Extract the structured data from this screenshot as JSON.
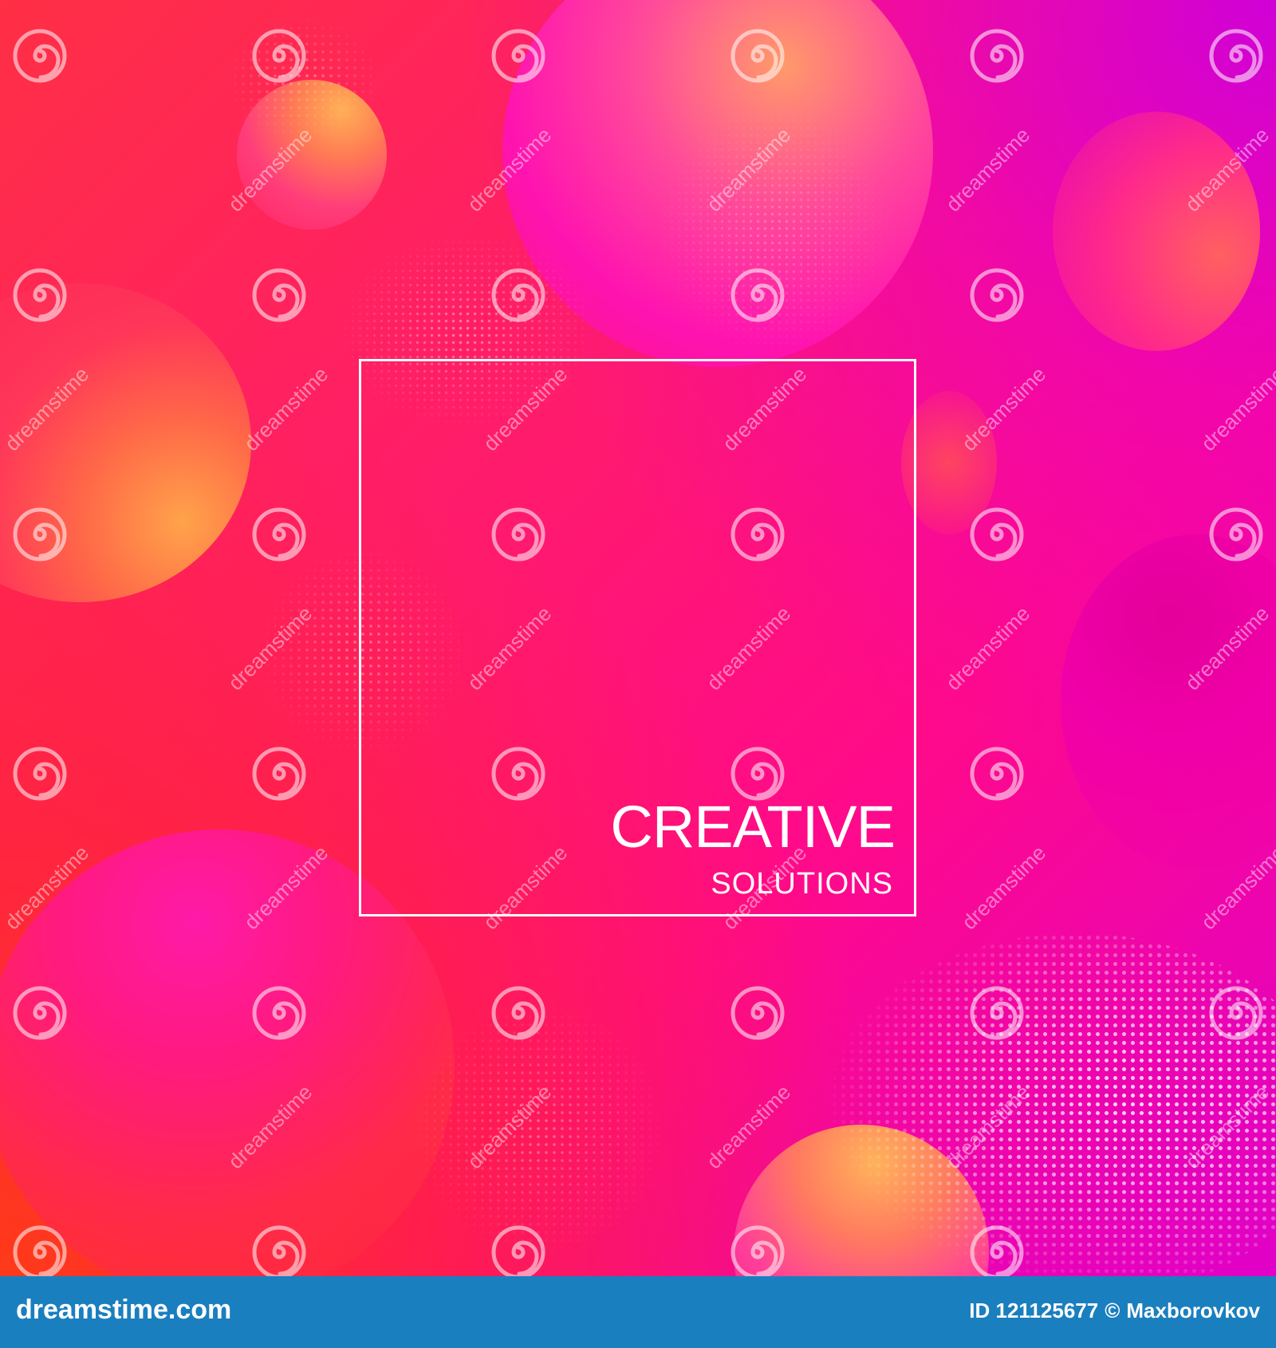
{
  "artwork": {
    "headline": "CREATIVE",
    "subheadline": "SOLUTIONS",
    "colors": {
      "primary": "#ff1a6e",
      "accent_magenta": "#e000c8",
      "accent_orange": "#ff7a48",
      "frame": "#ffffff"
    }
  },
  "watermark": {
    "icon": "spiral-logo-icon",
    "text": "dreamstime"
  },
  "footer": {
    "site": "dreamstime.com",
    "id_label": "ID 121125677",
    "copyright_symbol": "©",
    "author": "Maxborovkov",
    "background": "#1a7fbf"
  }
}
